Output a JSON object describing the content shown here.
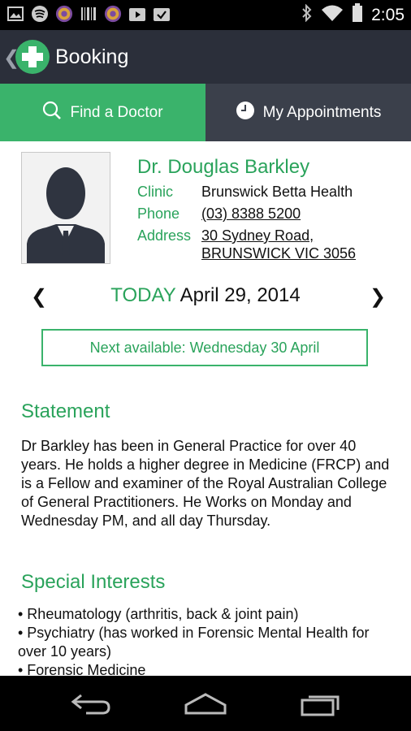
{
  "status_bar": {
    "time": "2:05",
    "icons": [
      "image-icon",
      "spotify-icon",
      "app-badge-icon",
      "barcode-icon",
      "app-badge-icon",
      "play-store-icon",
      "checkmark-bag-icon",
      "bluetooth-icon",
      "wifi-icon",
      "battery-icon"
    ]
  },
  "action_bar": {
    "title": "Booking"
  },
  "tabs": [
    {
      "label": "Find a Doctor",
      "icon": "search-icon",
      "active": true
    },
    {
      "label": "My Appointments",
      "icon": "clock-icon",
      "active": false
    }
  ],
  "doctor": {
    "name": "Dr. Douglas Barkley",
    "clinic_label": "Clinic",
    "clinic": "Brunswick Betta Health",
    "phone_label": "Phone",
    "phone": "(03) 8388 5200",
    "address_label": "Address",
    "address_line1": "30 Sydney Road,",
    "address_line2": "BRUNSWICK VIC  3056"
  },
  "date_nav": {
    "prev": "❮",
    "today": "TODAY",
    "date": "April 29, 2014",
    "next": "❯"
  },
  "next_available": "Next available: Wednesday 30 April",
  "statement": {
    "heading": "Statement",
    "text": "Dr Barkley has been in General Practice for over 40 years. He holds a higher degree in Medicine (FRCP) and is a Fellow and examiner of the Royal Australian College of General Practitioners. He Works on Monday and Wednesday PM, and all day Thursday."
  },
  "special_interests": {
    "heading": "Special Interests",
    "items": [
      "• Rheumatology (arthritis, back & joint pain)",
      "• Psychiatry (has worked in Forensic Mental Health for over 10 years)",
      "• Forensic Medicine"
    ]
  },
  "colors": {
    "accent": "#3ab36b",
    "actionbar": "#2b2f3a",
    "tab_inactive": "#3b404b"
  }
}
